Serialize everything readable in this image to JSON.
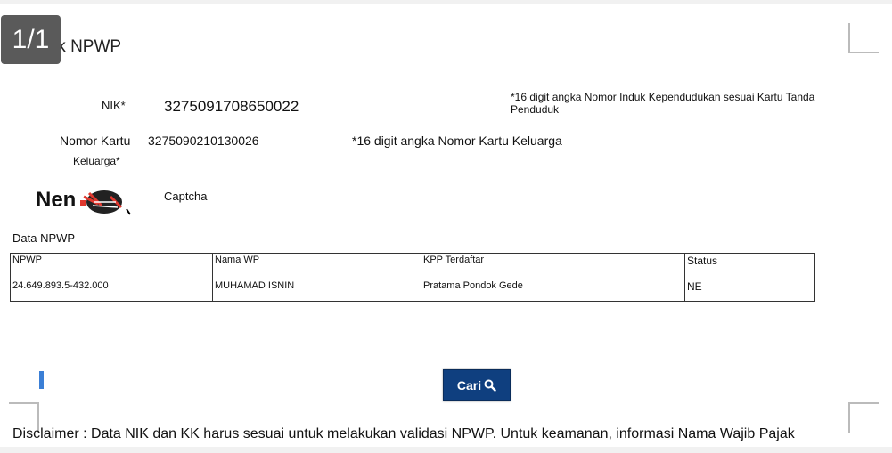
{
  "page_indicator": "1/1",
  "title": "Cek NPWP",
  "form": {
    "nik_label": "NIK*",
    "nik_value": "3275091708650022",
    "nik_hint": "*16 digit angka Nomor Induk Kependudukan sesuai Kartu Tanda Penduduk",
    "kk_label_line1": "Nomor Kartu",
    "kk_label_line2": "Keluarga*",
    "kk_value": "3275090210130026",
    "kk_hint": "*16 digit angka Nomor Kartu Keluarga",
    "captcha_text": "Nen",
    "captcha_label": "Captcha"
  },
  "data_section": {
    "title": "Data NPWP",
    "columns": [
      "NPWP",
      "Nama WP",
      "KPP Terdaftar",
      "Status"
    ],
    "rows": [
      [
        "24.649.893.5-432.000",
        "MUHAMAD ISNIN",
        "Pratama Pondok Gede",
        "NE"
      ]
    ]
  },
  "search_button": {
    "label": "Cari",
    "icon": "search-icon"
  },
  "disclaimer": "Disclaimer : Data NIK dan KK harus sesuai untuk melakukan validasi NPWP. Untuk keamanan, informasi Nama Wajib Pajak",
  "colors": {
    "button_bg": "#0f3f7f",
    "cursor": "#3b7fd6"
  }
}
